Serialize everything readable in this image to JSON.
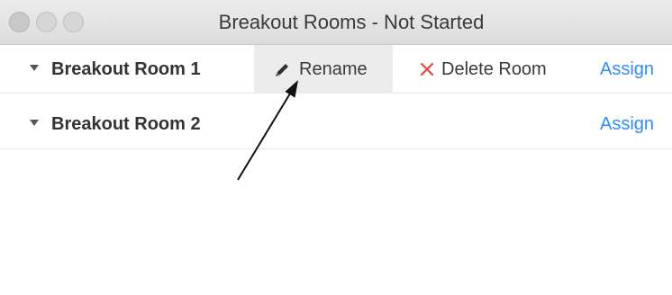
{
  "window": {
    "title": "Breakout Rooms - Not Started"
  },
  "rooms": [
    {
      "name": "Breakout Room 1",
      "rename_label": "Rename",
      "delete_label": "Delete Room",
      "assign_label": "Assign"
    },
    {
      "name": "Breakout Room 2",
      "assign_label": "Assign"
    }
  ],
  "icons": {
    "rename": "pencil-icon",
    "delete": "close-x-icon",
    "expand": "caret-down-icon"
  },
  "colors": {
    "assign_link": "#2d8cff",
    "delete_x": "#e8453c",
    "rename_hover_bg": "#ececec",
    "titlebar": "#e4e4e4"
  }
}
